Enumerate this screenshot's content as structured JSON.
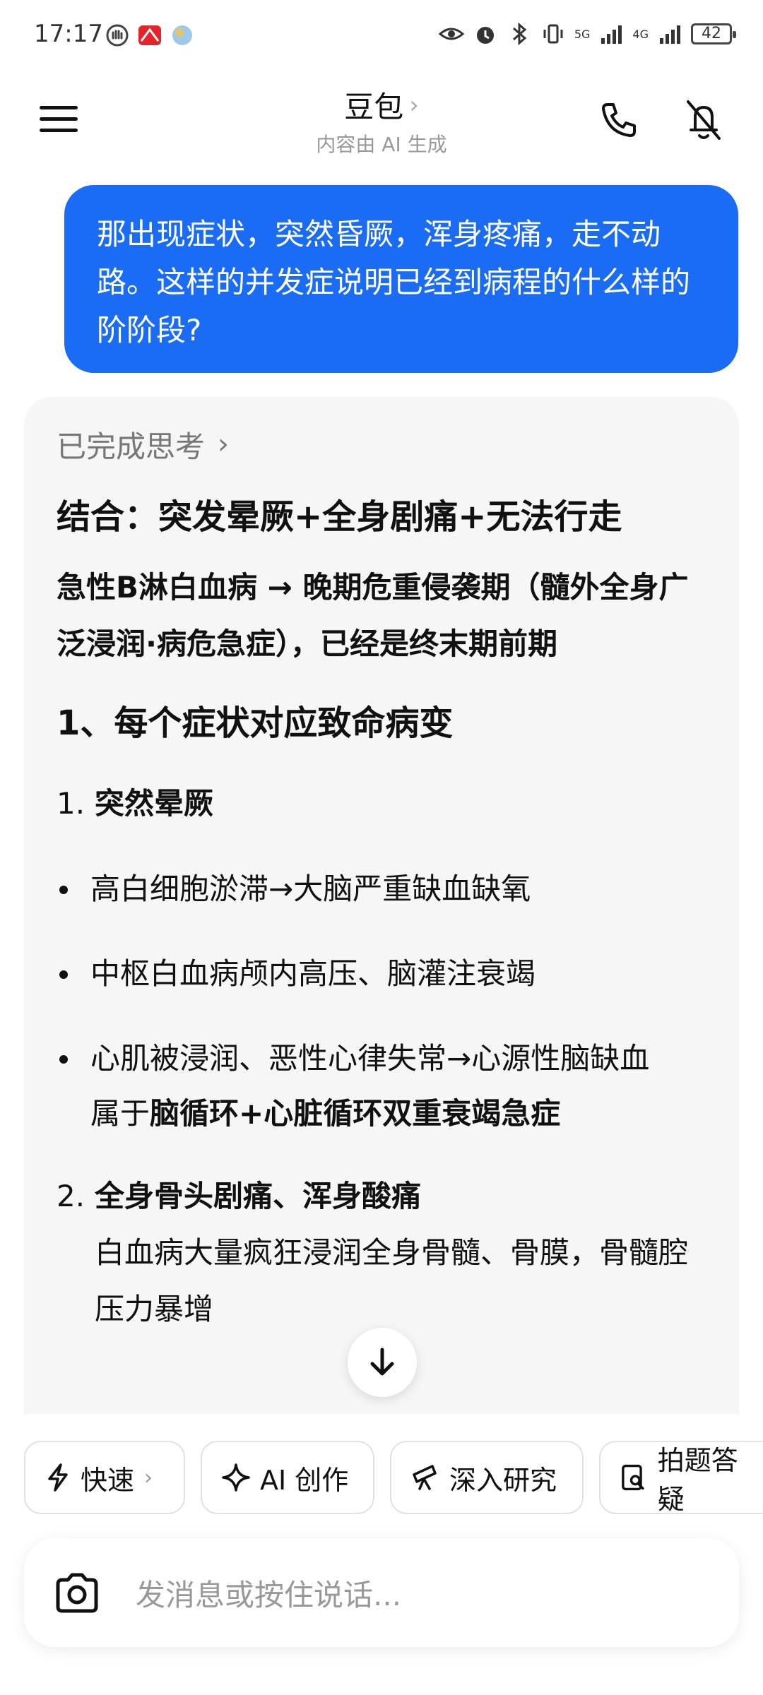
{
  "status_bar": {
    "time": "17:17",
    "network_1": "5G",
    "network_2": "4G",
    "battery": "42"
  },
  "header": {
    "title": "豆包",
    "subtitle": "内容由 AI 生成",
    "icons": [
      "menu-icon",
      "phone-icon",
      "mute-icon"
    ]
  },
  "user_message": "那出现症状，突然昏厥，浑身疼痛，走不动路。这样的并发症说明已经到病程的什么样的阶阶段?",
  "response": {
    "thinking_label": "已完成思考",
    "heading": "结合：突发晕厥+全身剧痛+无法行走",
    "conclusion": "急性B淋白血病 → 晚期危重侵袭期（髓外全身广泛浸润·病危急症），已经是终末期前期",
    "section_title": "1、每个症状对应致命病变",
    "item1": {
      "num": "1.",
      "title": "突然晕厥"
    },
    "bullets": [
      "高白细胞淤滞→大脑严重缺血缺氧",
      "中枢白血病颅内高压、脑灌注衰竭",
      "心肌被浸润、恶性心律失常→心源性脑缺血"
    ],
    "bullet3_sub_prefix": "属于",
    "bullet3_sub_bold": "脑循环+心脏循环双重衰竭急症",
    "item2": {
      "num": "2.",
      "title": "全身骨头剧痛、浑身酸痛",
      "desc": "白血病大量疯狂浸润全身骨髓、骨膜，骨髓腔压力暴增"
    }
  },
  "quick_actions": [
    {
      "label": "快速",
      "chevron": "›"
    },
    {
      "label": "AI 创作"
    },
    {
      "label": "深入研究"
    },
    {
      "label": "拍题答疑"
    }
  ],
  "input": {
    "placeholder": "发消息或按住说话..."
  }
}
